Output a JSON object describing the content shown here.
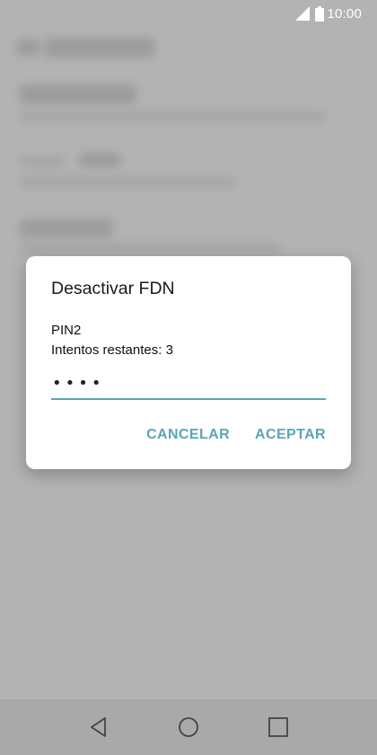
{
  "status_bar": {
    "time": "10:00",
    "icons": [
      "signal-icon",
      "battery-icon"
    ]
  },
  "dialog": {
    "title": "Desactivar FDN",
    "pin_label": "PIN2",
    "attempts_text": "Intentos restantes: 3",
    "pin_value": "••••",
    "cancel_label": "CANCELAR",
    "accept_label": "ACEPTAR"
  },
  "navigation": {
    "icons": [
      "back-icon",
      "home-icon",
      "recents-icon"
    ]
  },
  "colors": {
    "accent": "#5aa6b6",
    "scrim": "#b3b3b3",
    "dialog_bg": "#ffffff"
  }
}
